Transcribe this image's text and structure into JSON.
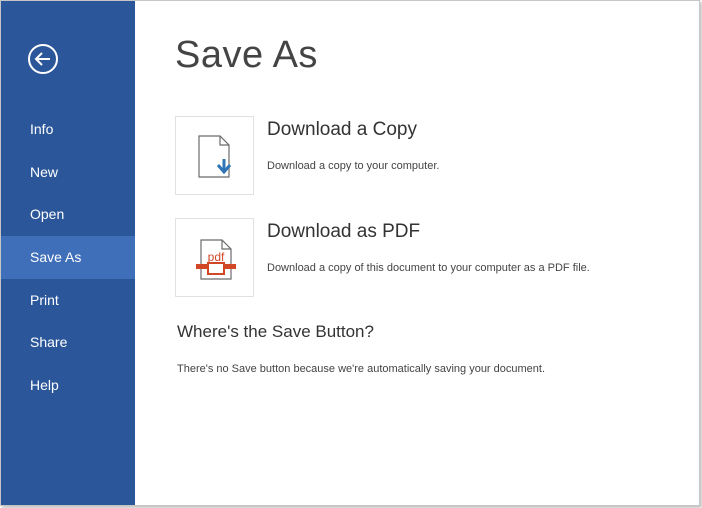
{
  "sidebar": {
    "back_icon": "back-arrow-circle-icon",
    "items": [
      {
        "label": "Info"
      },
      {
        "label": "New"
      },
      {
        "label": "Open"
      },
      {
        "label": "Save As",
        "selected": true
      },
      {
        "label": "Print"
      },
      {
        "label": "Share"
      },
      {
        "label": "Help"
      }
    ]
  },
  "main": {
    "title": "Save As",
    "options": [
      {
        "icon": "document-download-icon",
        "title": "Download a Copy",
        "description": "Download a copy to your computer."
      },
      {
        "icon": "pdf-document-icon",
        "icon_text": "pdf",
        "title": "Download as PDF",
        "description": "Download a copy of this document to your computer as a PDF file."
      }
    ],
    "save_heading": "Where's the Save Button?",
    "save_note": "There's no Save button because we're automatically saving your document."
  },
  "colors": {
    "sidebar_bg": "#2b579a",
    "sidebar_selected": "#3f6fb8",
    "accent_blue": "#2e75b6",
    "pdf_red": "#d24726"
  }
}
